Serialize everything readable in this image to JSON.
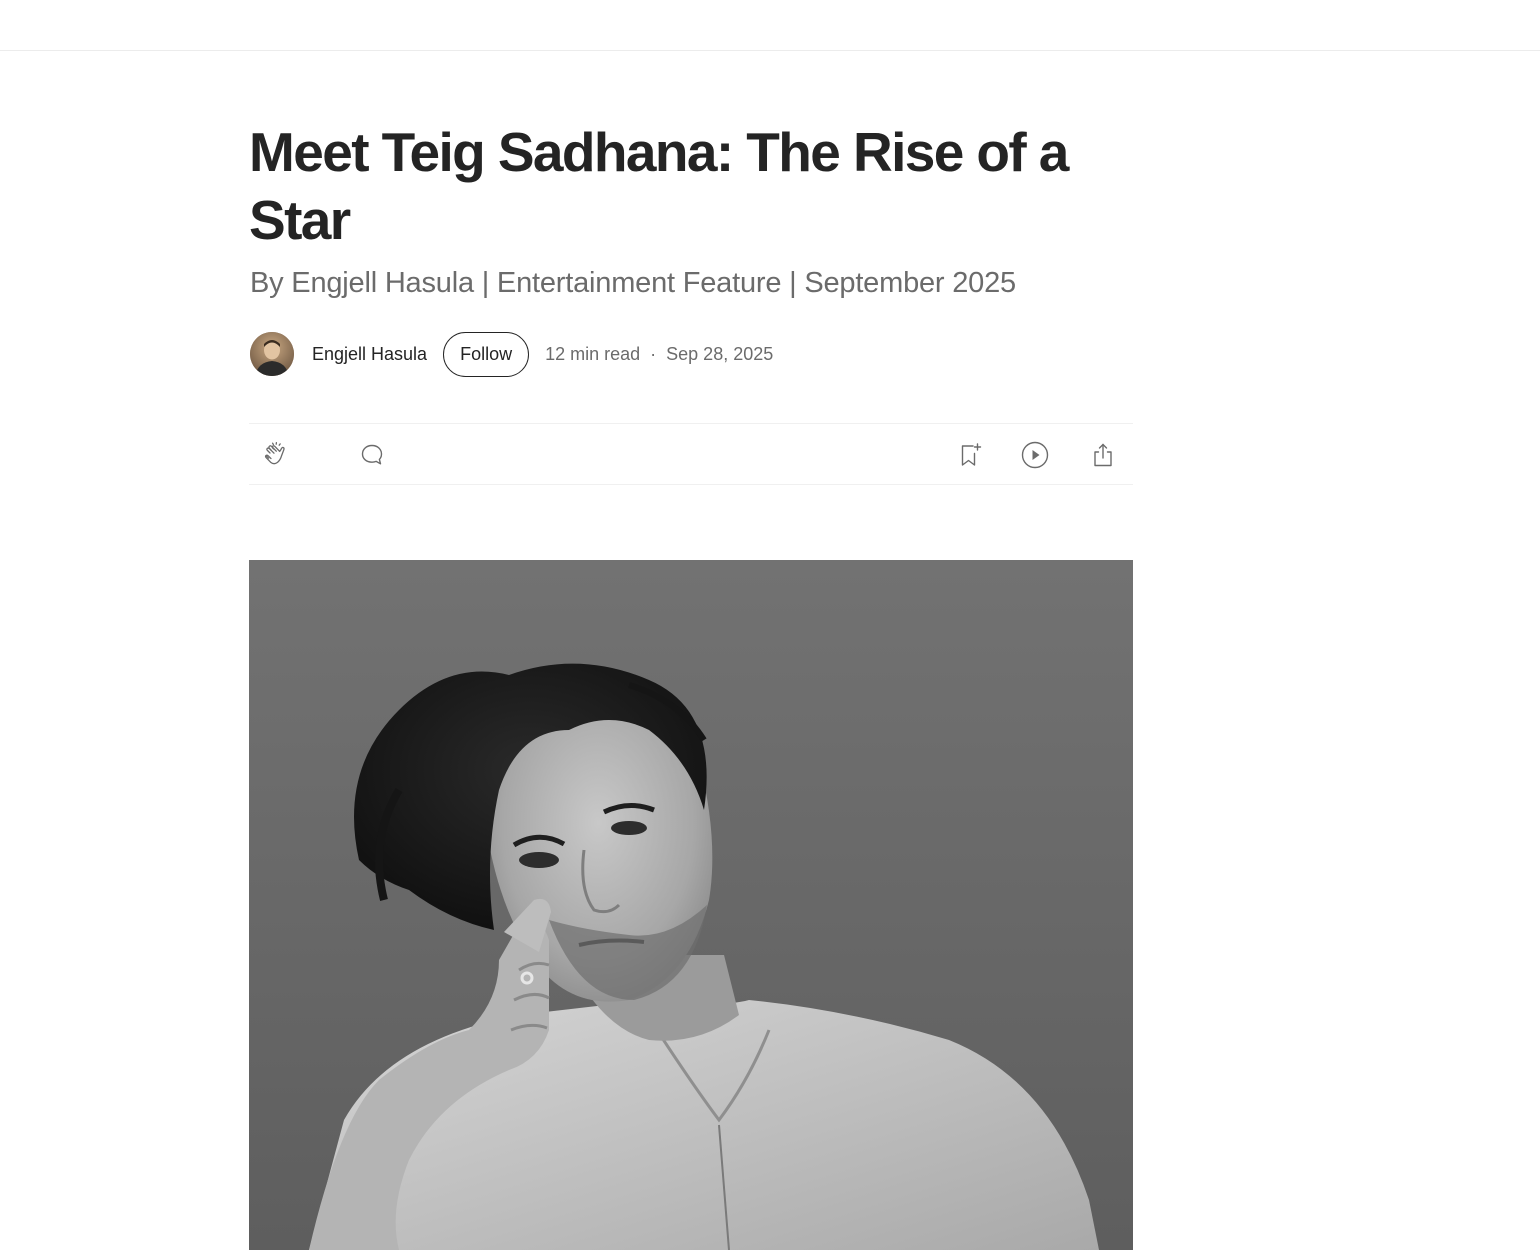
{
  "article": {
    "title": "Meet Teig Sadhana: The Rise of a Star",
    "subtitle": "By Engjell Hasula | Entertainment Feature | September 2025",
    "author": {
      "name": "Engjell Hasula",
      "follow_label": "Follow"
    },
    "read_time": "12 min read",
    "separator": "·",
    "published": "Sep 28, 2025"
  },
  "actions": {
    "left": [
      "clap-icon",
      "comment-icon"
    ],
    "right": [
      "bookmark-add-icon",
      "listen-play-icon",
      "share-icon"
    ]
  },
  "colors": {
    "text_primary": "#242424",
    "text_secondary": "#6b6b6b",
    "divider": "#f0f0f0"
  }
}
